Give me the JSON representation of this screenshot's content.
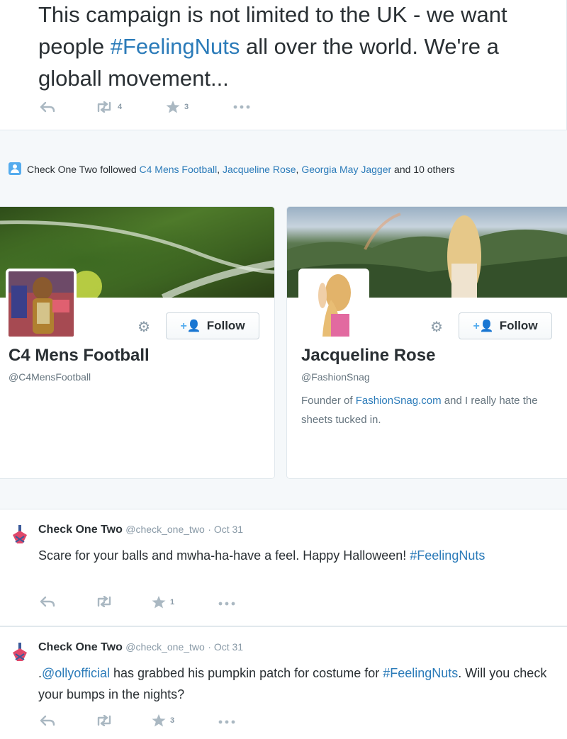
{
  "top_tweet": {
    "text_before": "This campaign is not limited to the UK - we want people ",
    "hashtag": "#FeelingNuts",
    "text_after": " all over the world. We're a globall movement...",
    "retweet_count": "4",
    "favorite_count": "3"
  },
  "follow_notification": {
    "actor": "Check One Two",
    "verb": " followed ",
    "account1": "C4 Mens Football",
    "sep1": ", ",
    "account2": "Jacqueline Rose",
    "sep2": ", ",
    "account3": "Georgia May Jagger",
    "and_others": " and 10 others"
  },
  "cards": [
    {
      "name": "C4 Mens Football",
      "handle": "@C4MensFootball",
      "follow_label": "Follow",
      "bio_before": "",
      "bio_link": "",
      "bio_after": ""
    },
    {
      "name": "Jacqueline Rose",
      "handle": "@FashionSnag",
      "follow_label": "Follow",
      "bio_before": "Founder of ",
      "bio_link": "FashionSnag.com",
      "bio_after": " and I really hate the sheets tucked in."
    }
  ],
  "tweets": [
    {
      "fullname": "Check One Two",
      "username": "@check_one_two",
      "time": "· Oct 31",
      "text_before": "Scare for your balls and mwha-ha-have a feel. Happy Halloween! ",
      "mention": "",
      "text_middle": "",
      "hashtag": "#FeelingNuts",
      "text_after": "",
      "favorite_count": "1"
    },
    {
      "fullname": "Check One Two",
      "username": "@check_one_two",
      "time": "· Oct 31",
      "text_before": ".",
      "mention": "@ollyofficial",
      "text_middle": " has grabbed his pumpkin patch for costume for ",
      "hashtag": "#FeelingNuts",
      "text_after": ". Will you check your bumps in the nights?",
      "favorite_count": "3"
    }
  ],
  "icons": {
    "reply": "reply-icon",
    "retweet": "retweet-icon",
    "favorite": "star-icon",
    "more": "more-icon",
    "gear": "gear-icon",
    "follow": "follow-user-icon"
  },
  "colors": {
    "link": "#2b7bb9",
    "accent": "#55acee",
    "muted": "#8899a6",
    "action": "#aab8c2"
  }
}
